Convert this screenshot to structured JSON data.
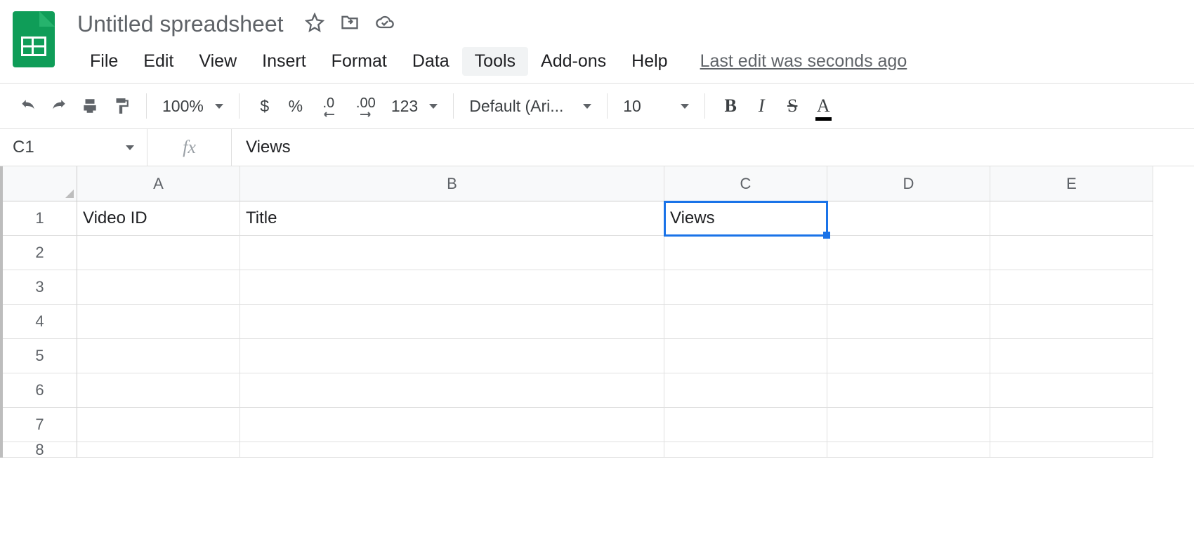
{
  "header": {
    "title": "Untitled spreadsheet"
  },
  "menubar": {
    "items": [
      "File",
      "Edit",
      "View",
      "Insert",
      "Format",
      "Data",
      "Tools",
      "Add-ons",
      "Help"
    ],
    "hovered_index": 6,
    "last_edit": "Last edit was seconds ago"
  },
  "toolbar": {
    "zoom": "100%",
    "currency": "$",
    "percent": "%",
    "dec_less": ".0",
    "dec_more": ".00",
    "numfmt": "123",
    "font": "Default (Ari...",
    "font_size": "10",
    "bold": "B",
    "italic": "I",
    "strike": "S",
    "text_color": "A"
  },
  "namebox": "C1",
  "fx_label": "fx",
  "formula_value": "Views",
  "columns": [
    "A",
    "B",
    "C",
    "D",
    "E"
  ],
  "rows": [
    "1",
    "2",
    "3",
    "4",
    "5",
    "6",
    "7",
    "8"
  ],
  "cells": {
    "A1": "Video ID",
    "B1": "Title",
    "C1": "Views"
  },
  "selected_cell": "C1"
}
